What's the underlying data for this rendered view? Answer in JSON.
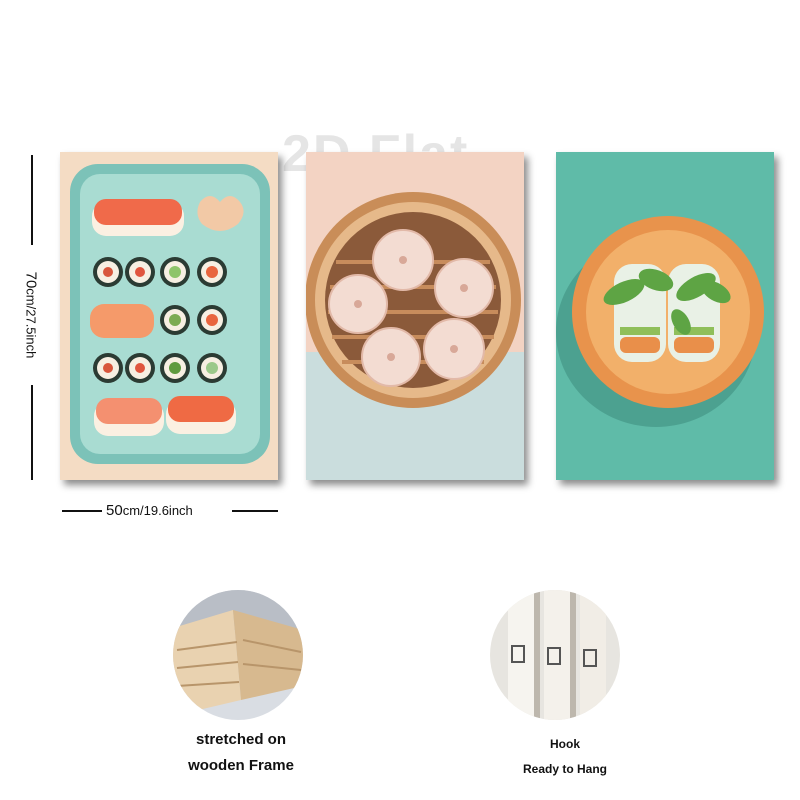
{
  "watermark": "2D Flat",
  "dimensions": {
    "height_value": "70",
    "height_rest": "cm/27.5inch",
    "width_value": "50",
    "width_rest": "cm/19.6inch"
  },
  "panels": [
    {
      "name": "sushi platter painting"
    },
    {
      "name": "dumpling steamer painting"
    },
    {
      "name": "spring rolls plate painting"
    }
  ],
  "features": {
    "frame": {
      "line1": "stretched on",
      "line2": "wooden Frame"
    },
    "hook": {
      "line1": "Hook",
      "line2": "Ready to Hang"
    }
  },
  "colors": {
    "sushi_bg": "#f4dcc4",
    "tray": "#8fcfc4",
    "dumpling_bg": "#f3d3c3",
    "steamer": "#d9a774",
    "roll_bg": "#5fbba8",
    "plate": "#e89a52"
  }
}
